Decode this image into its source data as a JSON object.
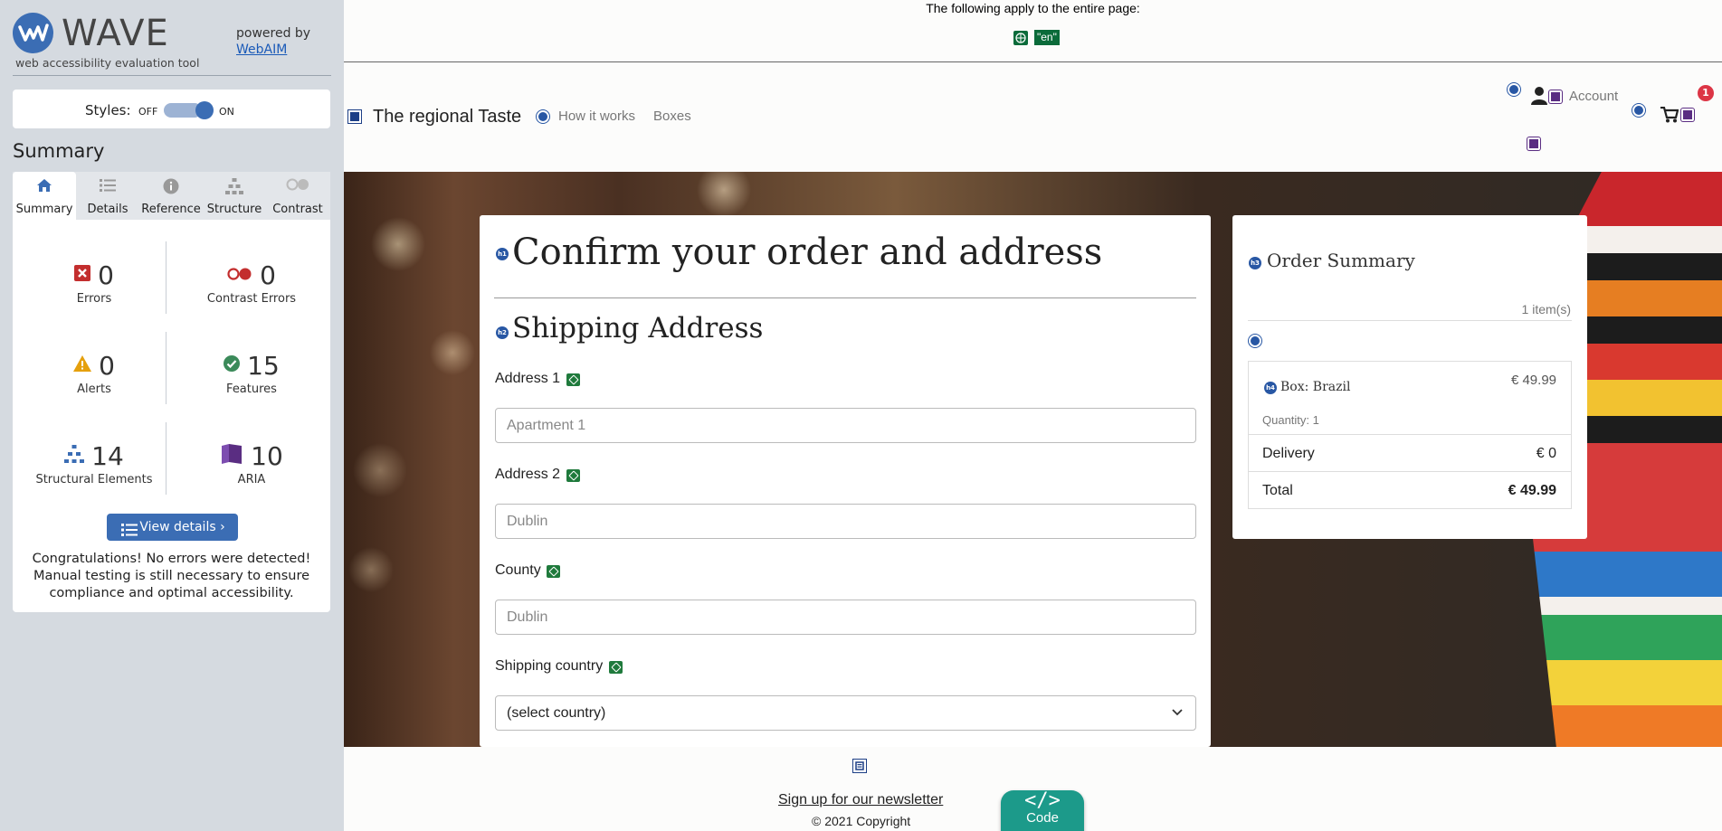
{
  "wave": {
    "title": "WAVE",
    "subtitle": "web accessibility evaluation tool",
    "powered_by": "powered by",
    "webaim_link": "WebAIM",
    "styles_label": "Styles:",
    "styles_off": "OFF",
    "styles_on": "ON",
    "summary_heading": "Summary",
    "tabs": [
      {
        "label": "Summary",
        "icon": "home-icon",
        "active": true
      },
      {
        "label": "Details",
        "icon": "list-icon",
        "active": false
      },
      {
        "label": "Reference",
        "icon": "info-icon",
        "active": false
      },
      {
        "label": "Structure",
        "icon": "structure-icon",
        "active": false
      },
      {
        "label": "Contrast",
        "icon": "contrast-icon",
        "active": false
      }
    ],
    "stats": {
      "errors": {
        "count": "0",
        "label": "Errors"
      },
      "contrast_errors": {
        "count": "0",
        "label": "Contrast Errors"
      },
      "alerts": {
        "count": "0",
        "label": "Alerts"
      },
      "features": {
        "count": "15",
        "label": "Features"
      },
      "structural": {
        "count": "14",
        "label": "Structural Elements"
      },
      "aria": {
        "count": "10",
        "label": "ARIA"
      }
    },
    "view_details": "View details ›",
    "congrats": "Congratulations! No errors were detected! Manual testing is still necessary to ensure compliance and optimal accessibility.",
    "colors": {
      "accent": "#3b6db4",
      "error": "#c32e2e",
      "alert": "#e5a00d",
      "feature": "#3b8a5a",
      "aria": "#5a2d82"
    }
  },
  "page": {
    "notice": "The following apply to the entire page:",
    "lang_badge": "\"en\"",
    "brand": "The regional Taste",
    "nav": {
      "how_it_works": "How it works",
      "boxes": "Boxes",
      "account": "Account",
      "cart_count": "1"
    },
    "main": {
      "title": "Confirm your order and address",
      "shipping_heading": "Shipping Address",
      "fields": [
        {
          "label": "Address 1",
          "placeholder": "Apartment 1"
        },
        {
          "label": "Address 2",
          "placeholder": "Dublin"
        },
        {
          "label": "County",
          "placeholder": "Dublin"
        }
      ],
      "country_label": "Shipping country",
      "country_value": "(select country)"
    },
    "order_summary": {
      "title": "Order Summary",
      "item_count": "1 item(s)",
      "item_name": "Box: Brazil",
      "item_price": "€ 49.99",
      "item_qty": "Quantity: 1",
      "delivery_label": "Delivery",
      "delivery_value": "€ 0",
      "total_label": "Total",
      "total_value": "€ 49.99"
    },
    "footer": {
      "newsletter": "Sign up for our newsletter",
      "copyright": "© 2021 Copyright",
      "code_symbol": "</>",
      "code_label": "Code"
    }
  }
}
